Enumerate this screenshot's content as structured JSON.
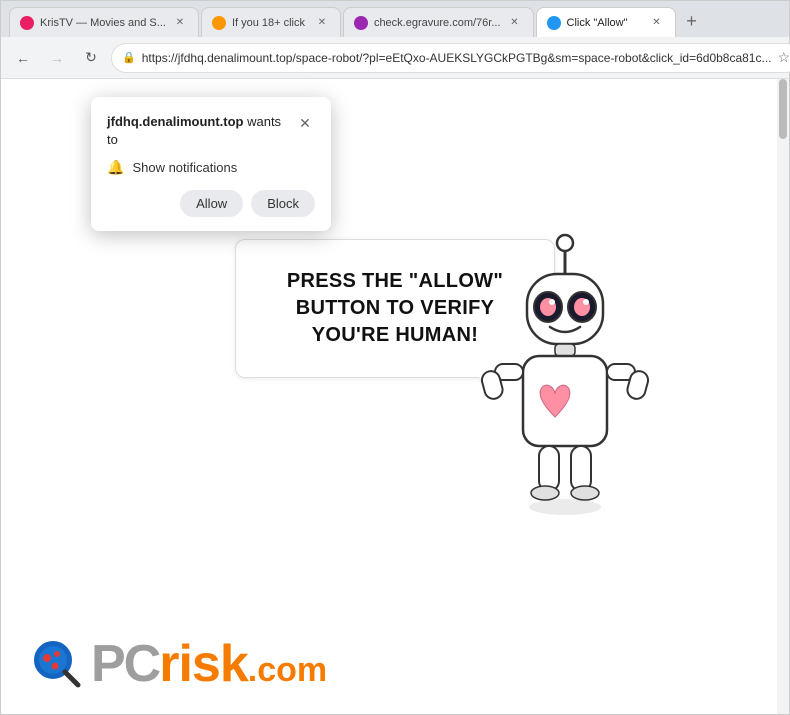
{
  "browser": {
    "tabs": [
      {
        "id": 1,
        "title": "KrisTV — Movies and S...",
        "favicon_color": "#e91e63",
        "active": false
      },
      {
        "id": 2,
        "title": "If you 18+ click",
        "favicon_color": "#ff9800",
        "active": false
      },
      {
        "id": 3,
        "title": "check.egravure.com/76r...",
        "favicon_color": "#9c27b0",
        "active": false
      },
      {
        "id": 4,
        "title": "Click \"Allow\"",
        "favicon_color": "#2196f3",
        "active": true
      }
    ],
    "url": "https://jfdhq.denalimount.top/space-robot/?pl=eEtQxo-AUEKSLYGCkPGTBg&sm=space-robot&click_id=6d0b8ca81c...",
    "back_disabled": false,
    "forward_disabled": true
  },
  "popup": {
    "site": "jfdhq.denalimount.top",
    "wants_to": " wants to",
    "notification_label": "Show notifications",
    "allow_label": "Allow",
    "block_label": "Block"
  },
  "page": {
    "message_line1": "PRESS THE \"ALLOW\" BUTTON TO VERIFY",
    "message_line2": "YOU'RE HUMAN!"
  },
  "logo": {
    "pc": "PC",
    "risk": "risk",
    "dotcom": ".com"
  },
  "icons": {
    "back": "←",
    "forward": "→",
    "reload": "↻",
    "lock": "🔒",
    "star": "☆",
    "download": "⬇",
    "profile": "👤",
    "menu": "⋮",
    "close": "✕",
    "bell": "🔔",
    "new_tab": "+"
  }
}
